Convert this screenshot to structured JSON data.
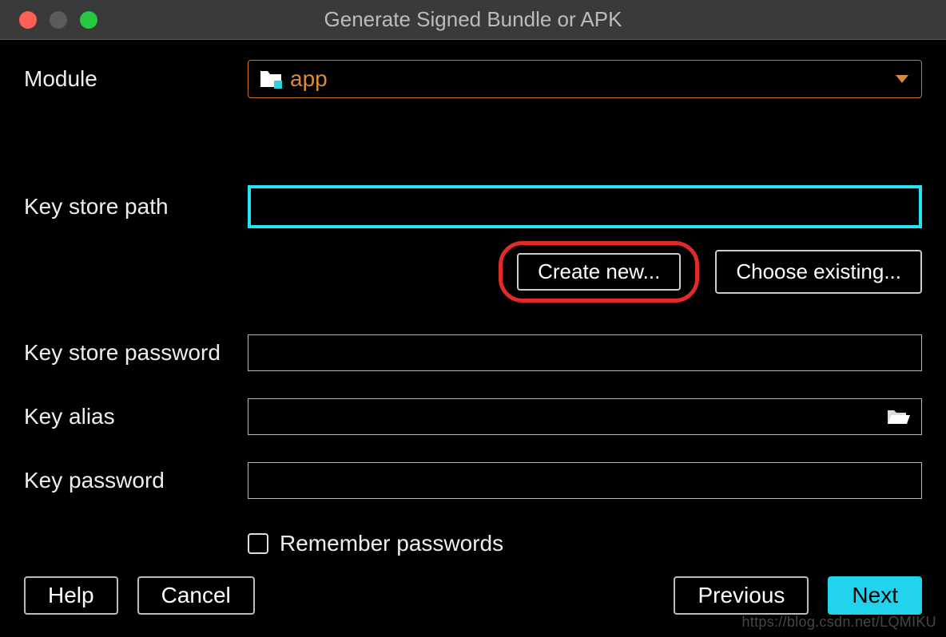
{
  "window": {
    "title": "Generate Signed Bundle or APK"
  },
  "labels": {
    "module": "Module",
    "key_store_path": "Key store path",
    "key_store_password": "Key store password",
    "key_alias": "Key alias",
    "key_password": "Key password",
    "remember_passwords": "Remember passwords"
  },
  "module": {
    "selected": "app"
  },
  "fields": {
    "key_store_path": "",
    "key_store_password": "",
    "key_alias": "",
    "key_password": ""
  },
  "buttons": {
    "create_new": "Create new...",
    "choose_existing": "Choose existing...",
    "help": "Help",
    "cancel": "Cancel",
    "previous": "Previous",
    "next": "Next"
  },
  "watermark": "https://blog.csdn.net/LQMIKU"
}
